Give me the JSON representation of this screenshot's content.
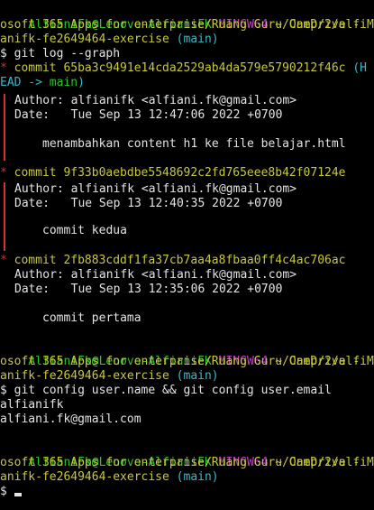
{
  "terminal": {
    "prompt1": {
      "user": "AlfianiFk@Lenovo-AlfianiFK",
      "shell": "MINGW64",
      "path_line1": "~/OneDrive - Micr",
      "path_line2": "osoft 365 Apps for enterprise/Ruang Guru Camp/2/alfi",
      "path_line3": "anifk-fe2649464-exercise",
      "branch": "(main)",
      "command": "git log --graph"
    },
    "log": {
      "commit1": {
        "marker": "*",
        "hash_line": "commit 65ba3c9491e14cda2529ab4da579e5790212f46c",
        "ref_tail": "(H",
        "ref_head": "EAD -> ",
        "ref_branch": "main",
        "ref_close": ")",
        "author": "Author: alfianifk <alfiani.fk@gmail.com>",
        "date": "Date:   Tue Sep 13 12:47:06 2022 +0700",
        "message": "menambahkan content h1 ke file belajar.html"
      },
      "commit2": {
        "marker": "*",
        "hash_line": "commit 9f33b0aebdbe5548692c2fd765eee8b42f07124e",
        "author": "Author: alfianifk <alfiani.fk@gmail.com>",
        "date": "Date:   Tue Sep 13 12:40:35 2022 +0700",
        "message": "commit kedua"
      },
      "commit3": {
        "marker": "*",
        "hash_line": "commit 2fb883cddf1fa37cb7aa4a8fbaa0ff4c4ac706ac",
        "author": "Author: alfianifk <alfiani.fk@gmail.com>",
        "date": "Date:   Tue Sep 13 12:35:06 2022 +0700",
        "message": "commit pertama"
      }
    },
    "prompt2": {
      "user": "AlfianiFk@Lenovo-AlfianiFK",
      "shell": "MINGW64",
      "path_line1": "~/OneDrive - Micr",
      "path_line2": "osoft 365 Apps for enterprise/Ruang Guru Camp/2/alfi",
      "path_line3": "anifk-fe2649464-exercise",
      "branch": "(main)",
      "command": "git config user.name && git config user.email",
      "output1": "alfianifk",
      "output2": "alfiani.fk@gmail.com"
    },
    "prompt3": {
      "user": "AlfianiFk@Lenovo-AlfianiFK",
      "shell": "MINGW64",
      "path_line1": "~/OneDrive - Micr",
      "path_line2": "osoft 365 Apps for enterprise/Ruang Guru Camp/2/alfi",
      "path_line3": "anifk-fe2649464-exercise",
      "branch": "(main)"
    },
    "dollar": "$"
  }
}
